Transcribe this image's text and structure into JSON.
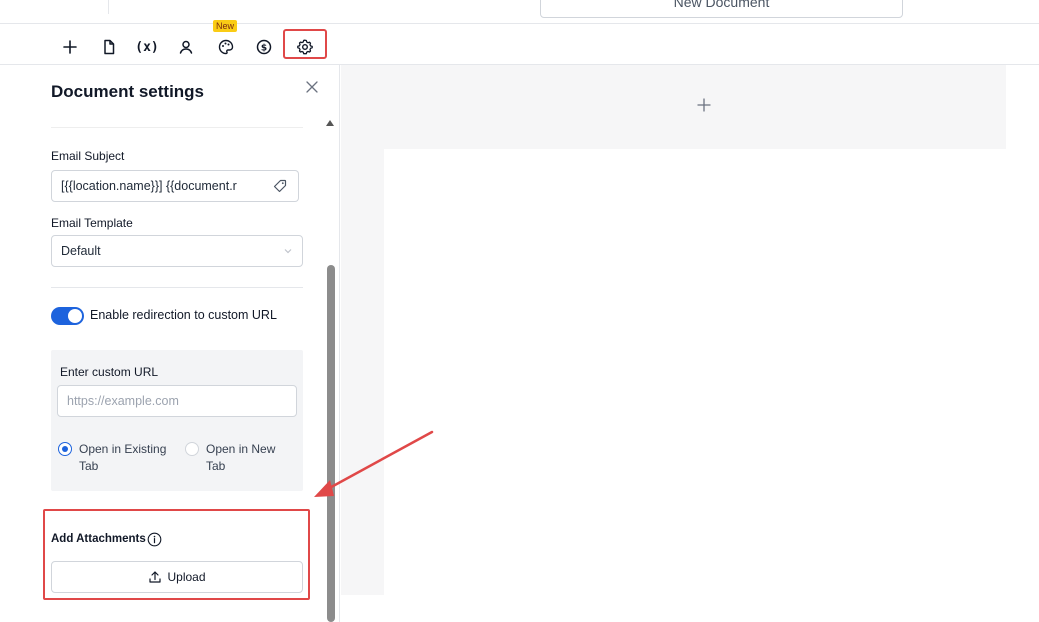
{
  "header": {
    "document_title": "New Document"
  },
  "toolbar": {
    "new_badge": "New",
    "items": [
      {
        "name": "add",
        "icon": "plus-icon"
      },
      {
        "name": "page",
        "icon": "file-icon"
      },
      {
        "name": "variables",
        "icon": "variable-icon",
        "label": "(x)"
      },
      {
        "name": "recipients",
        "icon": "user-icon"
      },
      {
        "name": "theme",
        "icon": "palette-icon"
      },
      {
        "name": "pricing",
        "icon": "dollar-circle-icon"
      },
      {
        "name": "settings",
        "icon": "gear-icon"
      }
    ]
  },
  "panel": {
    "title": "Document settings",
    "email_subject_label": "Email Subject",
    "email_subject_value": "[{{location.name}}] {{document.r",
    "email_template_label": "Email Template",
    "email_template_value": "Default",
    "redirect_toggle_label": "Enable redirection to custom URL",
    "redirect_enabled": true,
    "custom_url_label": "Enter custom URL",
    "custom_url_placeholder": "https://example.com",
    "radio_existing_line1": "Open in Existing",
    "radio_existing_line2": "Tab",
    "radio_new_line1": "Open in New",
    "radio_new_line2": "Tab",
    "selected_option": "existing",
    "attachments_label": "Add Attachments",
    "upload_label": "Upload"
  },
  "colors": {
    "accent": "#1d63dd",
    "highlight": "#e04848",
    "badge": "#facc15"
  }
}
